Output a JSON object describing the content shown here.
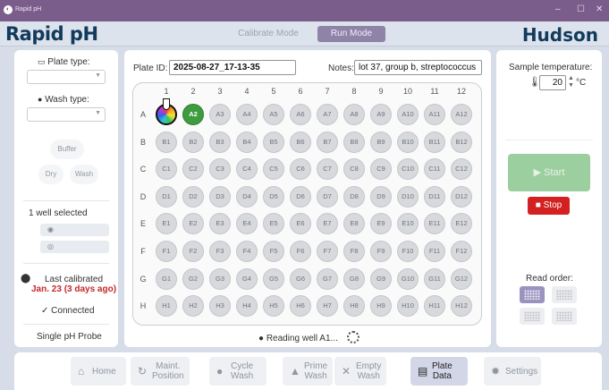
{
  "window": {
    "title": "Rapid pH",
    "minimize": "–",
    "maximize": "☐",
    "close": "✕"
  },
  "header": {
    "brand": "Rapid pH",
    "partner": "Hudson",
    "tabs": [
      {
        "label": "Calibrate Mode",
        "active": false
      },
      {
        "label": "Run Mode",
        "active": true
      }
    ]
  },
  "left": {
    "plate_type_label": "Plate type:",
    "wash_type_label": "Wash type:",
    "buffer": "Buffer",
    "dry": "Dry",
    "wash": "Wash",
    "wells_selected": "1 well selected",
    "last_calibrated_label": "Last calibrated",
    "last_calibrated_value": "Jan. 23 (3 days ago)",
    "connected": "Connected",
    "probe": "Single pH Probe"
  },
  "center": {
    "plate_id_label": "Plate ID:",
    "plate_id": "2025-08-27_17-13-35",
    "notes_label": "Notes:",
    "notes": "lot 37, group b, streptococcus",
    "columns": [
      "1",
      "2",
      "3",
      "4",
      "5",
      "6",
      "7",
      "8",
      "9",
      "10",
      "11",
      "12"
    ],
    "rows": [
      "A",
      "B",
      "C",
      "D",
      "E",
      "F",
      "G",
      "H"
    ],
    "current_well": "A1",
    "completed_wells": [
      "A2"
    ],
    "status": "Reading well A1..."
  },
  "right": {
    "sample_temp_label": "Sample temperature:",
    "temperature": "20",
    "temp_unit": "°C",
    "start": "Start",
    "stop": "Stop",
    "read_order_label": "Read order:"
  },
  "nav": [
    {
      "icon": "home-icon",
      "glyph": "⌂",
      "label": "Home"
    },
    {
      "icon": "maint-position-icon",
      "glyph": "↻",
      "label": "Maint.\nPosition"
    },
    {
      "icon": "cycle-wash-icon",
      "glyph": "●",
      "label": "Cycle\nWash"
    },
    {
      "icon": "prime-wash-icon",
      "glyph": "▲",
      "label": "Prime\nWash"
    },
    {
      "icon": "empty-wash-icon",
      "glyph": "✕",
      "label": "Empty\nWash"
    },
    {
      "icon": "plate-data-icon",
      "glyph": "▤",
      "label": "Plate\nData"
    },
    {
      "icon": "settings-icon",
      "glyph": "✹",
      "label": "Settings"
    }
  ],
  "colors": {
    "accent": "#8f83a8",
    "done": "#3f9b3f",
    "stop": "#d32020",
    "start_disabled": "#9ccf9f",
    "calibrated": "#c62828"
  }
}
